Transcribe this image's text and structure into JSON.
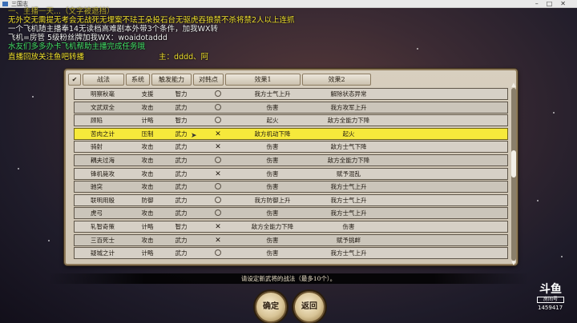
{
  "window": {
    "title": "三国志"
  },
  "overlay": {
    "line0": "一、主播一天...（文字被遮挡）",
    "line1": "无外交无需提无考会无战死无埋案不珐王朵投石台无驱虎吞狼禁不杀将禁2人以上连抓",
    "line2": "一个飞机随主播奉14无读档高难剧本外带3个条件，加我WX转",
    "line3": "飞机=房管 5级粉丝牌加我WX：woaidotaddd",
    "line4": "水友们多多办卡飞机帮助主播完成任务哦",
    "line5_a": "直播回放关注鱼吧转播",
    "line5_b": "主：dddd、阿"
  },
  "table": {
    "headers": [
      "✔",
      "战法",
      "系统",
      "触发能力",
      "对韩点",
      "效果1",
      "效果2"
    ],
    "rows": [
      {
        "name": "明察秋毫",
        "sys": "支援",
        "ability": "智力",
        "mark": "circle",
        "eff1": "我方士气上升",
        "eff2": "解除状态异常"
      },
      {
        "name": "文武双全",
        "sys": "攻击",
        "ability": "武力",
        "mark": "circle",
        "eff1": "伤害",
        "eff2": "我方攻军上升"
      },
      {
        "name": "顾陷",
        "sys": "计略",
        "ability": "智力",
        "mark": "circle",
        "eff1": "起火",
        "eff2": "敌方全能力下降"
      },
      {
        "name": "苦肉之计",
        "sys": "压制",
        "ability": "武力",
        "mark": "x",
        "eff1": "敌方机动下降",
        "eff2": "起火",
        "selected": true
      },
      {
        "name": "骑射",
        "sys": "攻击",
        "ability": "武力",
        "mark": "x",
        "eff1": "伤害",
        "eff2": "敌方士气下降"
      },
      {
        "name": "耦夫过海",
        "sys": "攻击",
        "ability": "武力",
        "mark": "circle",
        "eff1": "伤害",
        "eff2": "敌方全能力下降"
      },
      {
        "name": "锋机毙攻",
        "sys": "攻击",
        "ability": "武力",
        "mark": "x",
        "eff1": "伤害",
        "eff2": "赋予混乱"
      },
      {
        "name": "驰突",
        "sys": "攻击",
        "ability": "武力",
        "mark": "circle",
        "eff1": "伤害",
        "eff2": "我方士气上升"
      },
      {
        "name": "联明用殷",
        "sys": "防御",
        "ability": "武力",
        "mark": "circle",
        "eff1": "我方防御上升",
        "eff2": "我方士气上升"
      },
      {
        "name": "虎弓",
        "sys": "攻击",
        "ability": "武力",
        "mark": "circle",
        "eff1": "伤害",
        "eff2": "我方士气上升"
      },
      {
        "name": "轧智奇策",
        "sys": "计略",
        "ability": "智力",
        "mark": "x",
        "eff1": "敌方全能力下降",
        "eff2": "伤害"
      },
      {
        "name": "三百死士",
        "sys": "攻击",
        "ability": "武力",
        "mark": "x",
        "eff1": "伤害",
        "eff2": "赋予挑衅"
      },
      {
        "name": "疑城之计",
        "sys": "计略",
        "ability": "武力",
        "mark": "circle",
        "eff1": "伤害",
        "eff2": "我方士气上升"
      }
    ]
  },
  "hint": "请设定新武将的战法（最多10个）。",
  "buttons": {
    "confirm": "确定",
    "back": "返回"
  },
  "logo": {
    "brand": "斗鱼",
    "subtitle": "房间号",
    "room_id": "1459417"
  }
}
